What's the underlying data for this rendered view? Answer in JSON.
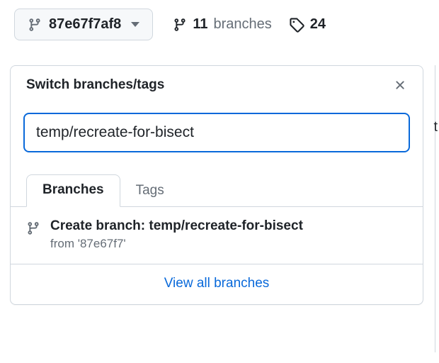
{
  "branchButton": {
    "ref": "87e67f7af8"
  },
  "meta": {
    "branchesCount": "11",
    "branchesLabel": "branches",
    "tagsCount": "24"
  },
  "dropdown": {
    "title": "Switch branches/tags",
    "searchValue": "temp/recreate-for-bisect",
    "tabs": {
      "branches": "Branches",
      "tags": "Tags"
    },
    "create": {
      "prefix": "Create branch: ",
      "name": "temp/recreate-for-bisect",
      "from": "from '87e67f7'"
    },
    "viewAll": "View all branches"
  },
  "stray": "t"
}
